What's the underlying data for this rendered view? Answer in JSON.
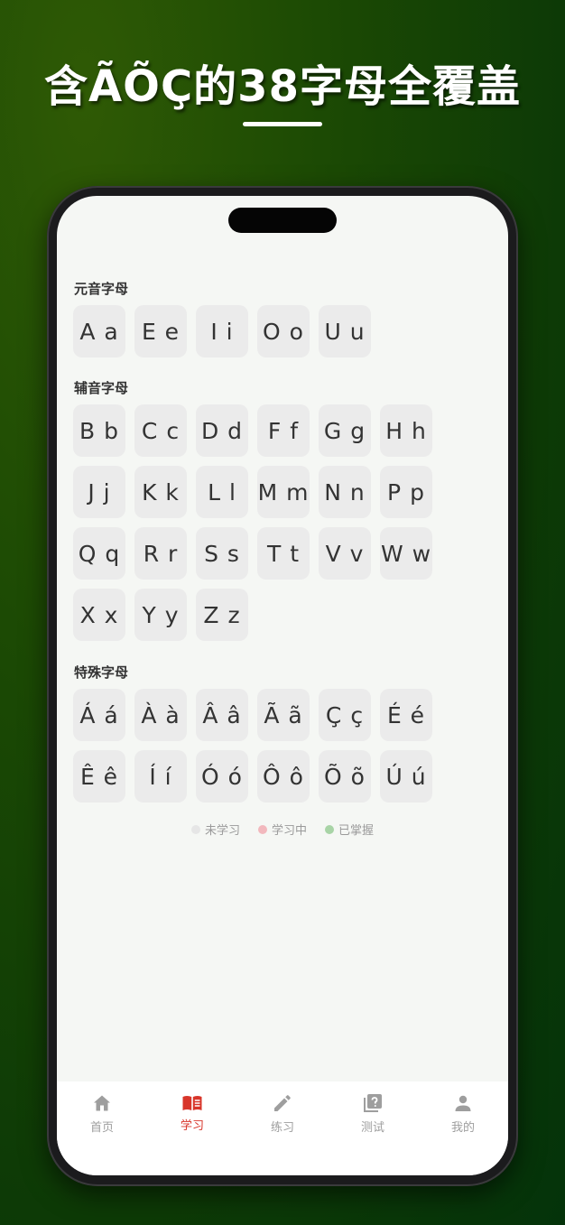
{
  "promo": {
    "title": "含ÃÕÇ的38字母全覆盖"
  },
  "sections": [
    {
      "title": "元音字母",
      "letters": [
        "A a",
        "E e",
        "I i",
        "O o",
        "U u"
      ]
    },
    {
      "title": "辅音字母",
      "letters": [
        "B b",
        "C c",
        "D d",
        "F f",
        "G g",
        "H h",
        "J j",
        "K k",
        "L l",
        "M m",
        "N n",
        "P p",
        "Q q",
        "R r",
        "S s",
        "T t",
        "V v",
        "W w",
        "X x",
        "Y y",
        "Z z"
      ]
    },
    {
      "title": "特殊字母",
      "letters": [
        "Á á",
        "À à",
        "Â â",
        "Ã ã",
        "Ç ç",
        "É é",
        "Ê ê",
        "Í í",
        "Ó ó",
        "Ô ô",
        "Õ õ",
        "Ú ú"
      ]
    }
  ],
  "legend": [
    {
      "label": "未学习",
      "color": "#e6e6e6"
    },
    {
      "label": "学习中",
      "color": "#f2b8bd"
    },
    {
      "label": "已掌握",
      "color": "#a8d4a6"
    }
  ],
  "tabs": [
    {
      "label": "首页",
      "icon": "home-icon"
    },
    {
      "label": "学习",
      "icon": "book-icon",
      "active": true
    },
    {
      "label": "练习",
      "icon": "pencil-icon"
    },
    {
      "label": "测试",
      "icon": "quiz-icon"
    },
    {
      "label": "我的",
      "icon": "person-icon"
    }
  ],
  "colors": {
    "accent": "#d8352a",
    "background_green": "#0d3a06",
    "tile": "#ebebeb",
    "tab_inactive": "#9e9e9e"
  }
}
